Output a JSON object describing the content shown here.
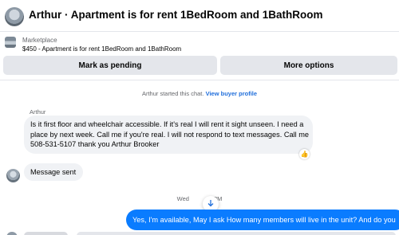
{
  "header": {
    "title": "Arthur · Apartment is for rent 1BedRoom and 1BathRoom"
  },
  "listing": {
    "source": "Marketplace",
    "price_title": "$450 - Apartment is for rent 1BedRoom and 1BathRoom"
  },
  "actions": {
    "pending_label": "Mark as pending",
    "options_label": "More options"
  },
  "system_message": {
    "text": "Arthur started this chat.",
    "link": "View buyer profile"
  },
  "incoming": {
    "sender": "Arthur",
    "lines": [
      "Is it first floor and wheelchair accessible. If it's real I will rent it sight unseen. I need a",
      "place by next week. Call me if you're real. I will not respond to text messages. Call me",
      "508-531-5107  thank you Arthur Brooker"
    ],
    "reaction": "👍",
    "status_message": "Message sent"
  },
  "date_divider": {
    "left": "Wed",
    "right": "PM"
  },
  "outgoing": {
    "text": "Yes, I'm available, May I ask How many members will live in the unit? And do you"
  },
  "colors": {
    "accent": "#0a7cff",
    "link": "#216fdb",
    "bubble_gray": "#f0f2f5",
    "button_gray": "#e4e6eb"
  },
  "icons": {
    "scroll_down": "arrow-down-icon",
    "reaction": "thumbs-up-icon"
  }
}
